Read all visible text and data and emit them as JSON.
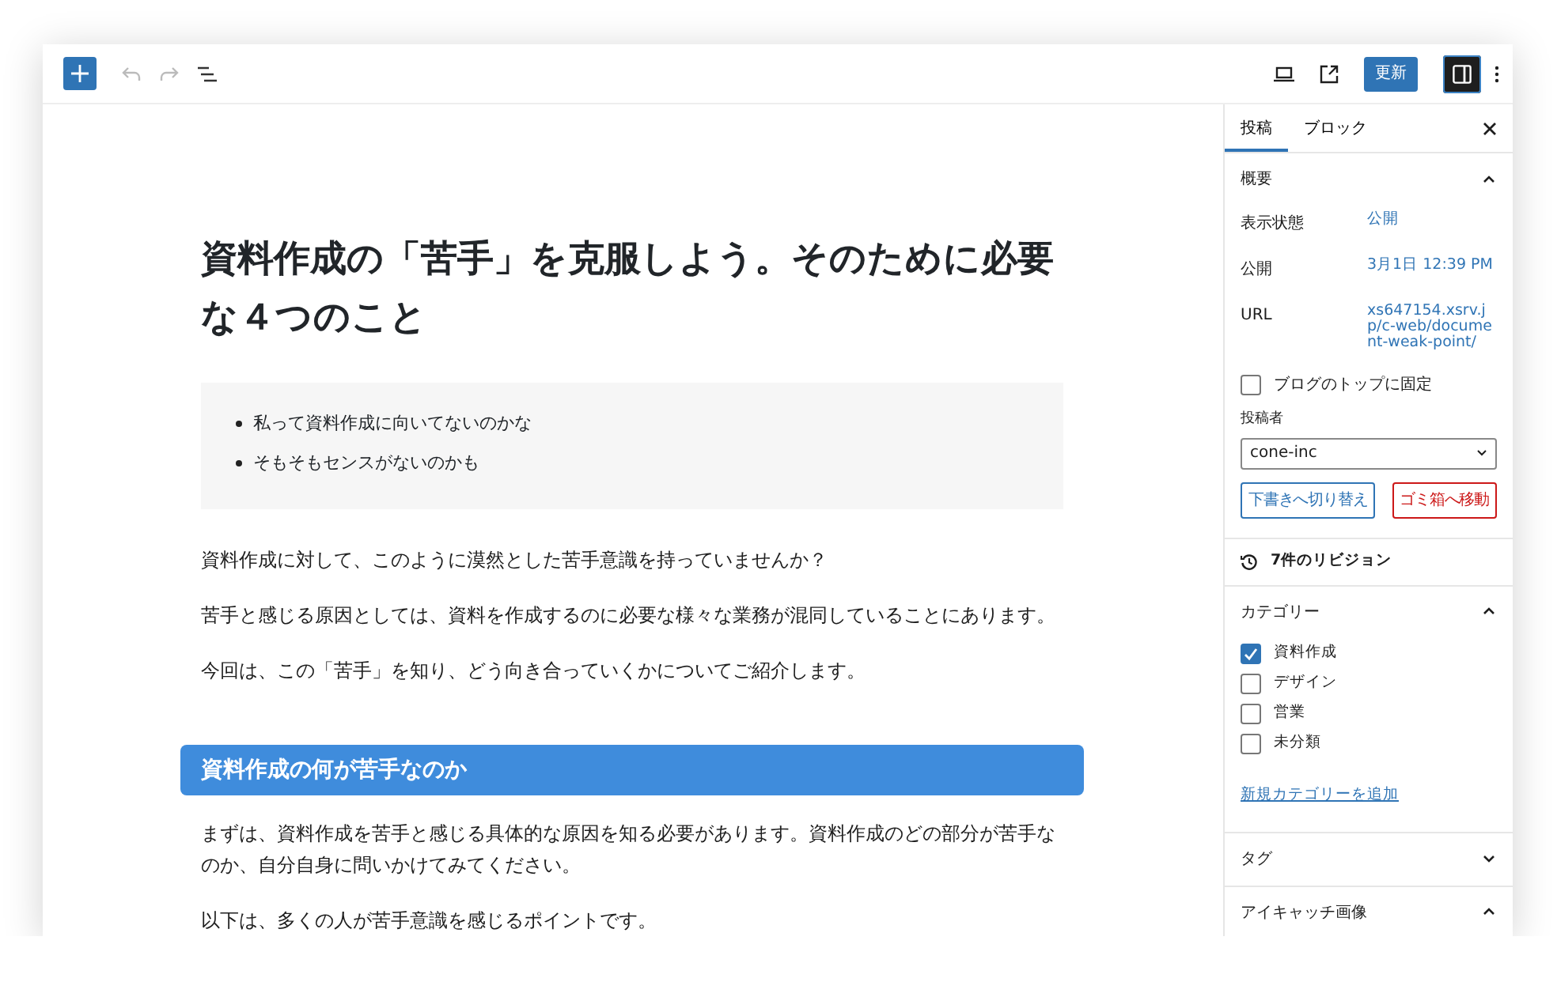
{
  "toolbar": {
    "update_button": "更新",
    "settings_toggle": {
      "selected": true
    }
  },
  "editor": {
    "title": "資料作成の「苦手」を克服しよう。そのために必要な４つのこと",
    "list_items": [
      "私って資料作成に向いてないのかな",
      "そもそもセンスがないのかも"
    ],
    "blocks": [
      {
        "kind": "paragraph",
        "text": "資料作成に対して、このように漠然とした苦手意識を持っていませんか？"
      },
      {
        "kind": "paragraph",
        "text": "苦手と感じる原因としては、資料を作成するのに必要な様々な業務が混同していることにあります。"
      },
      {
        "kind": "paragraph",
        "text": "今回は、この「苦手」を知り、どう向き合っていくかについてご紹介します。"
      },
      {
        "kind": "heading",
        "text": "資料作成の何が苦手なのか"
      },
      {
        "kind": "paragraph",
        "text": "まずは、資料作成を苦手と感じる具体的な原因を知る必要があります。資料作成のどの部分が苦手なのか、自分自身に問いかけてみてください。"
      },
      {
        "kind": "paragraph",
        "text": "以下は、多くの人が苦手意識を感じるポイントです。"
      }
    ]
  },
  "sidebar": {
    "tabs": [
      {
        "label": "投稿",
        "selected": true
      },
      {
        "label": "ブロック",
        "selected": false
      }
    ],
    "summary": {
      "title": "概要",
      "expanded": true,
      "rows": [
        {
          "label": "表示状態",
          "value": "公開"
        },
        {
          "label": "公開",
          "value": "3月1日 12:39 PM"
        },
        {
          "label": "URL",
          "value": "xs647154.xsrv.jp/c-web/document-weak-point/"
        }
      ],
      "sticky": {
        "label": "ブログのトップに固定",
        "checked": false
      },
      "author": {
        "label": "投稿者",
        "value": "cone-inc"
      },
      "buttons": [
        {
          "label": "下書きへ切り替え",
          "kind": "secondary"
        },
        {
          "label": "ゴミ箱へ移動",
          "kind": "destructive"
        }
      ]
    },
    "revisions": "7件のリビジョン",
    "categories": {
      "title": "カテゴリー",
      "expanded": true,
      "items": [
        {
          "label": "資料作成",
          "checked": true
        },
        {
          "label": "デザイン",
          "checked": false
        },
        {
          "label": "営業",
          "checked": false
        },
        {
          "label": "未分類",
          "checked": false
        }
      ],
      "add_link": "新規カテゴリーを追加"
    },
    "tags": {
      "title": "タグ",
      "expanded": false
    },
    "featured_image": {
      "title": "アイキャッチ画像",
      "expanded": true
    }
  }
}
